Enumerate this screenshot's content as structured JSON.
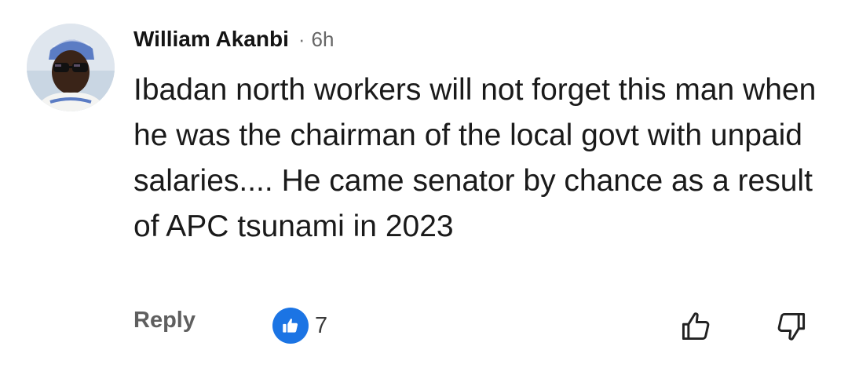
{
  "comment": {
    "author": "William Akanbi",
    "separator": "·",
    "time": "6h",
    "body": "Ibadan north workers will not forget this man when he was the chairman of the local govt with unpaid salaries.... He came senator by chance as a result of APC tsunami in 2023",
    "reply_label": "Reply",
    "like_count": "7"
  },
  "icons": {
    "like_badge": "thumbs-up-icon",
    "like_button": "thumbs-up-outline-icon",
    "dislike_button": "thumbs-down-outline-icon"
  },
  "colors": {
    "like_badge": "#1b74e4",
    "author": "#141414",
    "meta": "#666666",
    "reply": "#5f5f5f"
  }
}
